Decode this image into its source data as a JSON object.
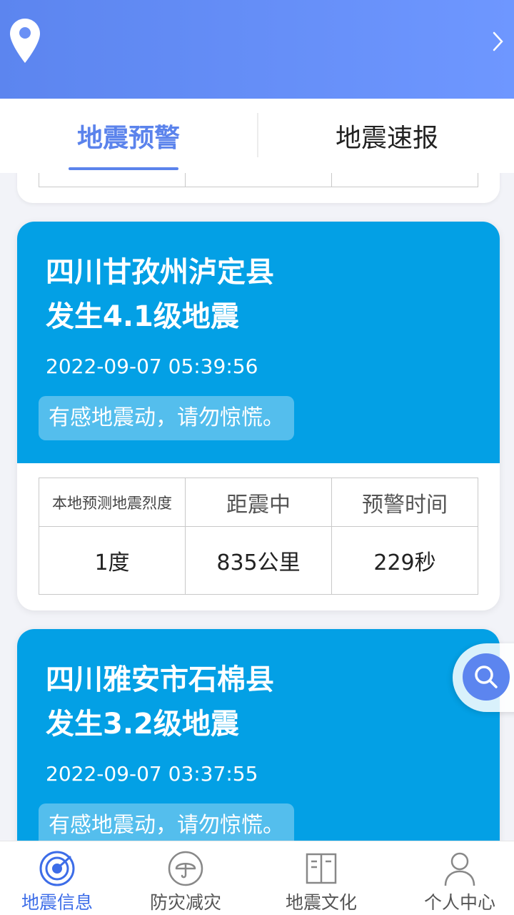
{
  "header": {
    "location_icon": "location-pin-icon",
    "chevron_icon": "chevron-right-icon"
  },
  "tabs": [
    {
      "label": "地震预警",
      "active": true
    },
    {
      "label": "地震速报",
      "active": false
    }
  ],
  "quakes": [
    {
      "title_line1": "四川甘孜州泸定县",
      "title_line2": "发生4.1级地震",
      "time": "2022-09-07 05:39:56",
      "note": "有感地震动，请勿惊慌。",
      "headers": [
        "本地预测地震烈度",
        "距震中",
        "预警时间"
      ],
      "values": [
        "1度",
        "835公里",
        "229秒"
      ]
    },
    {
      "title_line1": "四川雅安市石棉县",
      "title_line2": "发生3.2级地震",
      "time": "2022-09-07 03:37:55",
      "note": "有感地震动，请勿惊慌。"
    }
  ],
  "nav": [
    {
      "label": "地震信息",
      "icon": "radar-icon",
      "active": true
    },
    {
      "label": "防灾减灾",
      "icon": "umbrella-icon",
      "active": false
    },
    {
      "label": "地震文化",
      "icon": "book-icon",
      "active": false
    },
    {
      "label": "个人中心",
      "icon": "user-icon",
      "active": false
    }
  ],
  "colors": {
    "brand": "#5c85ef",
    "card": "#03a0e5",
    "active_nav": "#3d6de8"
  }
}
